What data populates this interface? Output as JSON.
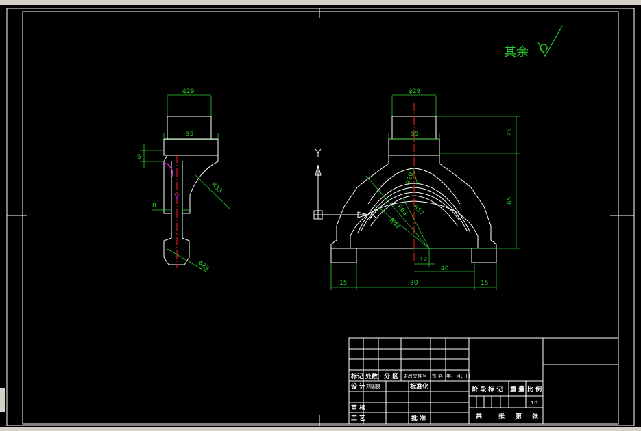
{
  "drawing": {
    "surface_note": "其余",
    "left_view": {
      "dims": [
        "ϕ29",
        "35",
        "6",
        "R33",
        "8",
        "ϕ23"
      ]
    },
    "front_view": {
      "dims": [
        "ϕ29",
        "35",
        "25",
        "65",
        "R20",
        "R63",
        "R57",
        "R44",
        "12",
        "40",
        "15",
        "80",
        "15"
      ]
    }
  },
  "title_block": {
    "header_labels": [
      "标记",
      "处数",
      "分 区",
      "更改文件号",
      "签 名",
      "年、月、日"
    ],
    "row_labels": [
      "设 计",
      "审 核",
      "工 艺"
    ],
    "designer": "刘国良",
    "standardize": "标准化",
    "approve": "批 准",
    "stage_labels": [
      "阶 段 标 记",
      "重 量",
      "比 例"
    ],
    "scale": "1:1",
    "sheet_labels": [
      "共",
      "张",
      "第",
      "张"
    ]
  },
  "colors": {
    "background": "#000000",
    "outline": "#ffffff",
    "dimension": "#2ad12a",
    "centerline": "#ff2020",
    "highlight": "#ff22ff"
  }
}
